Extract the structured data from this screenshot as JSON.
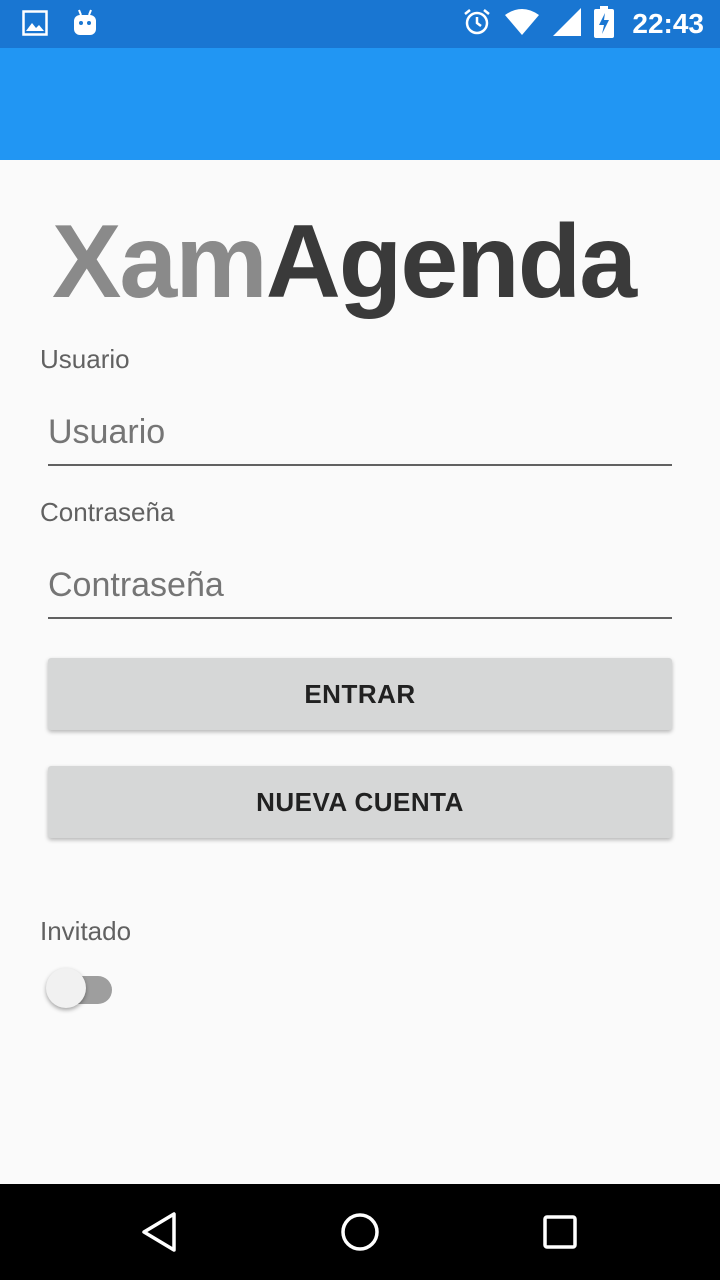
{
  "status_bar": {
    "time": "22:43",
    "left_icons": [
      "image-icon",
      "android-icon"
    ],
    "right_icons": [
      "alarm-icon",
      "wifi-icon",
      "signal-icon",
      "battery-charging-icon"
    ],
    "background": "#1976d2"
  },
  "app_bar": {
    "background": "#2196f3"
  },
  "logo": {
    "part1": "Xam",
    "part2": "Agenda"
  },
  "form": {
    "username_label": "Usuario",
    "username_placeholder": "Usuario",
    "password_label": "Contraseña",
    "password_placeholder": "Contraseña",
    "login_button": "ENTRAR",
    "new_account_button": "NUEVA CUENTA",
    "guest_label": "Invitado",
    "guest_enabled": false
  },
  "nav_bar": {
    "icons": [
      "back-icon",
      "home-icon",
      "recents-icon"
    ]
  }
}
